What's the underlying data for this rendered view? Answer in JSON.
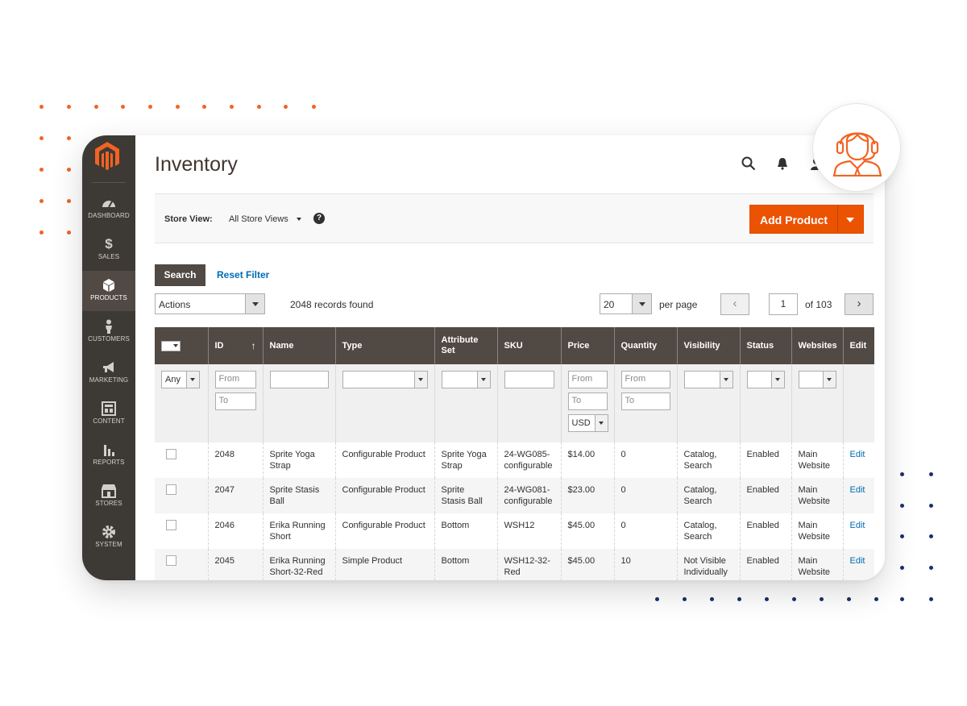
{
  "colors": {
    "accent": "#eb5202",
    "sidebar": "#3d3935",
    "header_row": "#514943",
    "link": "#006bb4",
    "decor_orange": "#f26322",
    "decor_navy": "#1c2f6b"
  },
  "sidebar": {
    "logo_icon": "magento-logo-icon",
    "items": [
      {
        "label": "DASHBOARD",
        "icon": "speedometer-icon"
      },
      {
        "label": "SALES",
        "icon": "dollar-icon"
      },
      {
        "label": "PRODUCTS",
        "icon": "cube-icon",
        "active": true
      },
      {
        "label": "CUSTOMERS",
        "icon": "person-icon"
      },
      {
        "label": "MARKETING",
        "icon": "megaphone-icon"
      },
      {
        "label": "CONTENT",
        "icon": "layout-icon"
      },
      {
        "label": "REPORTS",
        "icon": "bar-chart-icon"
      },
      {
        "label": "STORES",
        "icon": "storefront-icon"
      },
      {
        "label": "SYSTEM",
        "icon": "gear-icon"
      }
    ]
  },
  "header": {
    "title": "Inventory",
    "icons": [
      "search-icon",
      "bell-icon",
      "user-icon"
    ]
  },
  "store_bar": {
    "label": "Store View:",
    "selected": "All Store Views",
    "help": "?",
    "add_button": "Add Product"
  },
  "toolbar": {
    "search_label": "Search",
    "reset_label": "Reset Filter",
    "actions_label": "Actions",
    "records": "2048 records found",
    "per_page_value": "20",
    "per_page_label": "per page",
    "prev": "‹",
    "next": "›",
    "current_page": "1",
    "of_pages": "of 103"
  },
  "grid": {
    "columns": [
      "ID",
      "Name",
      "Type",
      "Attribute Set",
      "SKU",
      "Price",
      "Quantity",
      "Visibility",
      "Status",
      "Websites",
      "Edit"
    ],
    "sort_indicator": "↑",
    "filters": {
      "any": "Any",
      "from": "From",
      "to": "To",
      "currency": "USD"
    },
    "rows": [
      {
        "id": "2048",
        "name": "Sprite Yoga Strap",
        "type": "Configurable Product",
        "attribute_set": "Sprite Yoga Strap",
        "sku": "24-WG085-configurable",
        "price": "$14.00",
        "quantity": "0",
        "visibility": "Catalog, Search",
        "status": "Enabled",
        "websites": "Main Website",
        "edit": "Edit"
      },
      {
        "id": "2047",
        "name": "Sprite Stasis Ball",
        "type": "Configurable Product",
        "attribute_set": "Sprite Stasis Ball",
        "sku": "24-WG081-configurable",
        "price": "$23.00",
        "quantity": "0",
        "visibility": "Catalog, Search",
        "status": "Enabled",
        "websites": "Main Website",
        "edit": "Edit"
      },
      {
        "id": "2046",
        "name": "Erika Running Short",
        "type": "Configurable Product",
        "attribute_set": "Bottom",
        "sku": "WSH12",
        "price": "$45.00",
        "quantity": "0",
        "visibility": "Catalog, Search",
        "status": "Enabled",
        "websites": "Main Website",
        "edit": "Edit"
      },
      {
        "id": "2045",
        "name": "Erika Running Short-32-Red",
        "type": "Simple Product",
        "attribute_set": "Bottom",
        "sku": "WSH12-32-Red",
        "price": "$45.00",
        "quantity": "10",
        "visibility": "Not Visible Individually",
        "status": "Enabled",
        "websites": "Main Website",
        "edit": "Edit"
      }
    ]
  },
  "support_badge": {
    "icon": "headset-support-agent-icon"
  }
}
